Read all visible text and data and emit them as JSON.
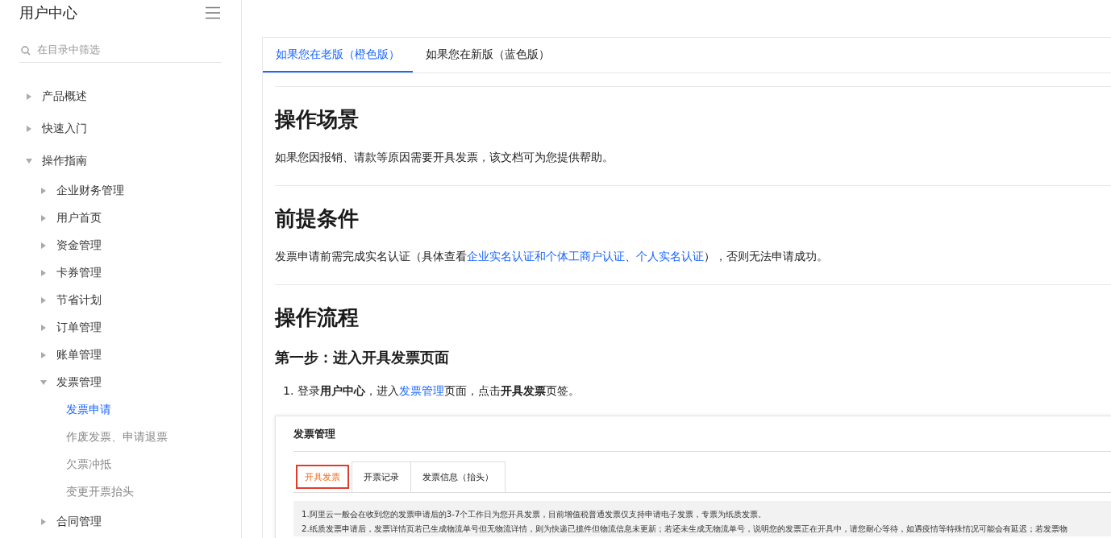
{
  "sidebar": {
    "title": "用户中心",
    "filter": {
      "placeholder": "在目录中筛选"
    },
    "items": [
      {
        "label": "产品概述",
        "expanded": false,
        "selected": false
      },
      {
        "label": "快速入门",
        "expanded": false,
        "selected": false
      },
      {
        "label": "操作指南",
        "expanded": true,
        "selected": false,
        "children": [
          {
            "label": "企业财务管理",
            "expanded": false,
            "selected": false
          },
          {
            "label": "用户首页",
            "expanded": false,
            "selected": false
          },
          {
            "label": "资金管理",
            "expanded": false,
            "selected": false
          },
          {
            "label": "卡券管理",
            "expanded": false,
            "selected": false
          },
          {
            "label": "节省计划",
            "expanded": false,
            "selected": false
          },
          {
            "label": "订单管理",
            "expanded": false,
            "selected": false
          },
          {
            "label": "账单管理",
            "expanded": false,
            "selected": false
          },
          {
            "label": "发票管理",
            "expanded": true,
            "selected": false,
            "children": [
              {
                "label": "发票申请",
                "selected": true
              },
              {
                "label": "作废发票、申请退票",
                "selected": false
              },
              {
                "label": "欠票冲抵",
                "selected": false
              },
              {
                "label": "变更开票抬头",
                "selected": false
              }
            ]
          },
          {
            "label": "合同管理",
            "expanded": false,
            "selected": false
          }
        ]
      }
    ]
  },
  "tabs": [
    {
      "label": "如果您在老版（橙色版）",
      "selected": true
    },
    {
      "label": "如果您在新版（蓝色版）",
      "selected": false
    }
  ],
  "article": [
    {
      "kind": "h2",
      "text": "操作场景"
    },
    {
      "kind": "p",
      "segments": [
        {
          "kind": "text",
          "text": "如果您因报销、请款等原因需要开具发票，该文档可为您提供帮助。"
        }
      ]
    },
    {
      "kind": "hr"
    },
    {
      "kind": "h2",
      "text": "前提条件"
    },
    {
      "kind": "p",
      "segments": [
        {
          "kind": "text",
          "text": "发票申请前需完成实名认证（具体查看"
        },
        {
          "kind": "link",
          "text": "企业实名认证和个体工商户认证"
        },
        {
          "kind": "text",
          "text": "、"
        },
        {
          "kind": "link",
          "text": "个人实名认证"
        },
        {
          "kind": "text",
          "text": "），否则无法申请成功。"
        }
      ]
    },
    {
      "kind": "hr"
    },
    {
      "kind": "h2",
      "text": "操作流程"
    },
    {
      "kind": "h3",
      "text": "第一步：进入开具发票页面"
    },
    {
      "kind": "li",
      "number": "1.",
      "segments": [
        {
          "kind": "text",
          "text": "登录"
        },
        {
          "kind": "bold",
          "text": "用户中心"
        },
        {
          "kind": "text",
          "text": "，进入"
        },
        {
          "kind": "link",
          "text": "发票管理"
        },
        {
          "kind": "text",
          "text": "页面，点击"
        },
        {
          "kind": "bold",
          "text": "开具发票"
        },
        {
          "kind": "text",
          "text": "页签。"
        }
      ]
    },
    {
      "kind": "shot",
      "title": "发票管理",
      "tabs": [
        {
          "label": "开具发票",
          "selected": true,
          "highlighted": true
        },
        {
          "label": "开票记录",
          "selected": false,
          "highlighted": false
        },
        {
          "label": "发票信息（抬头）",
          "selected": false,
          "highlighted": false
        }
      ],
      "notes": [
        "1.阿里云一般会在收到您的发票申请后的3-7个工作日为您开具发票，目前增值税普通发票仅支持申请电子发票，专票为纸质发票。",
        "2.纸质发票申请后，发票详情页若已生成物流单号但无物流详情，则为快递已揽件但物流信息未更新；若还未生成无物流单号，说明您的发票正在开具中，请您耐心等待，如遇疫情等特殊情况可能会有延迟；若发票物"
      ]
    }
  ]
}
